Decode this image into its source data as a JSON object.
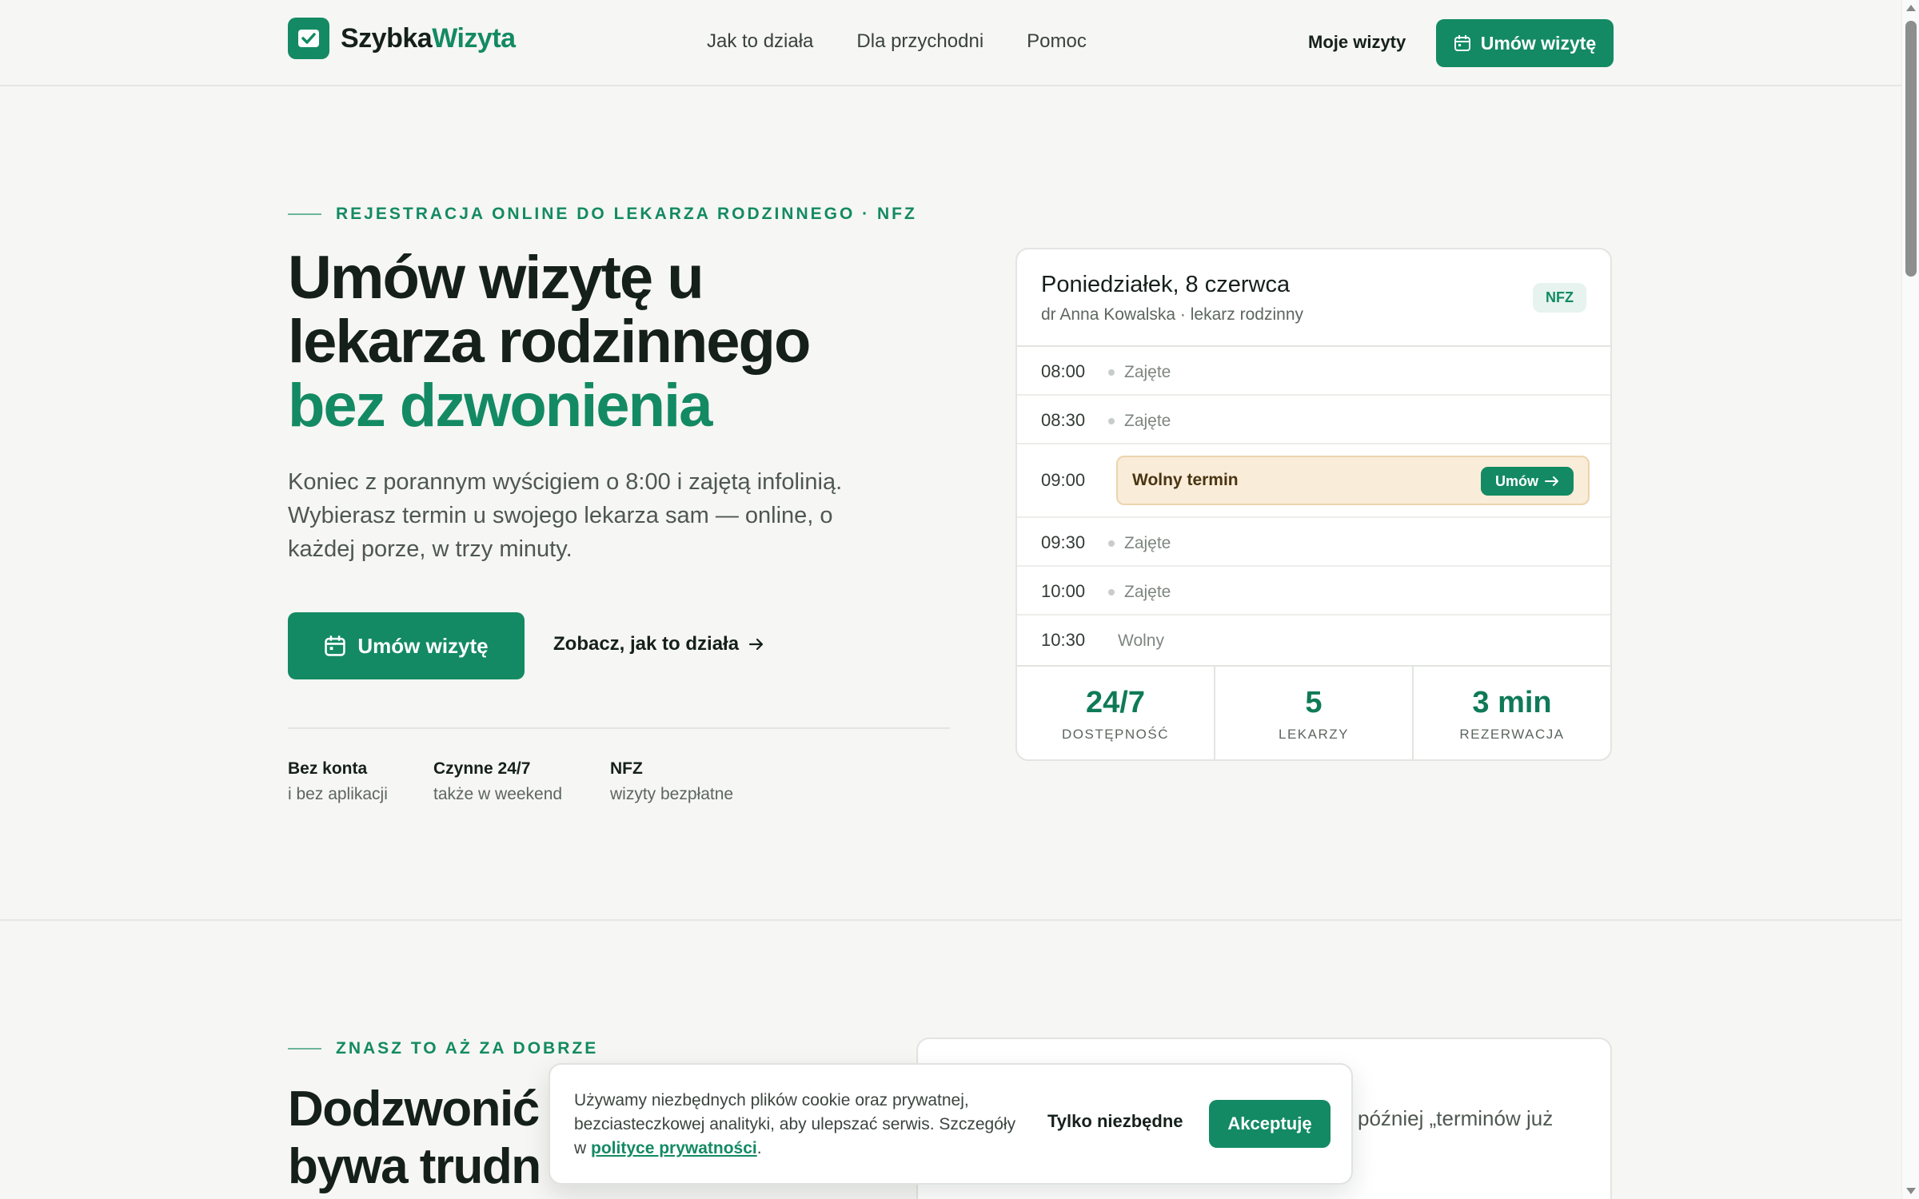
{
  "header": {
    "logo_part1": "Szybka",
    "logo_part2": "Wizyta",
    "nav": [
      "Jak to działa",
      "Dla przychodni",
      "Pomoc"
    ],
    "my_visits": "Moje wizyty",
    "cta": "Umów wizytę"
  },
  "hero": {
    "eyebrow": "REJESTRACJA ONLINE DO LEKARZA RODZINNEGO · NFZ",
    "title_line1": "Umów wizytę u",
    "title_line2": "lekarza rodzinnego",
    "title_accent": "bez dzwonienia",
    "lead": "Koniec z porannym wyścigiem o 8:00 i zajętą infolinią. Wybierasz termin u swojego lekarza sam — online, o każdej porze, w trzy minuty.",
    "primary_button": "Umów wizytę",
    "secondary_link": "Zobacz, jak to działa",
    "features": [
      {
        "title": "Bez konta",
        "subtitle": "i bez aplikacji"
      },
      {
        "title": "Czynne 24/7",
        "subtitle": "także w weekend"
      },
      {
        "title": "NFZ",
        "subtitle": "wizyty bezpłatne"
      }
    ]
  },
  "schedule": {
    "day": "Poniedziałek, 8 czerwca",
    "doctor": "dr Anna Kowalska · lekarz rodzinny",
    "badge": "NFZ",
    "slots": [
      {
        "time": "08:00",
        "status": "Zajęte"
      },
      {
        "time": "08:30",
        "status": "Zajęte"
      },
      {
        "time": "09:00",
        "status": "Wolny termin",
        "action": "Umów"
      },
      {
        "time": "09:30",
        "status": "Zajęte"
      },
      {
        "time": "10:00",
        "status": "Zajęte"
      },
      {
        "time": "10:30",
        "status": "Wolny"
      }
    ],
    "stats": [
      {
        "value": "24/7",
        "label": "DOSTĘPNOŚĆ"
      },
      {
        "value": "5",
        "label": "LEKARZY"
      },
      {
        "value": "3 min",
        "label": "REZERWACJA"
      }
    ]
  },
  "section2": {
    "eyebrow": "ZNASZ TO AŻ ZA DOBRZE",
    "title_line1": "Dodzwonić",
    "title_line2": "bywa trudn",
    "card_text": "później „terminów już"
  },
  "cookie": {
    "text": "Używamy niezbędnych plików cookie oraz prywatnej, bezciasteczkowej analityki, aby ulepszać serwis. Szczegóły w",
    "link": "polityce prywatności",
    "text_end": ".",
    "essential_button": "Tylko niezbędne",
    "accept_button": "Akceptuję"
  },
  "colors": {
    "brand": "#138a63",
    "free_slot_bg": "#f9ecd9",
    "ink": "#15201b"
  }
}
